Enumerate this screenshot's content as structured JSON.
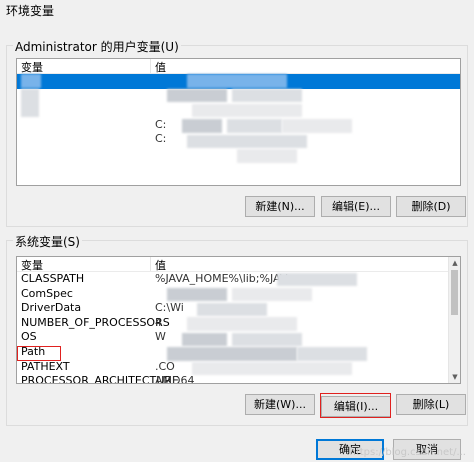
{
  "window": {
    "title": "环境变量"
  },
  "user_vars": {
    "group_label": "Administrator 的用户变量(U)",
    "columns": {
      "name": "变量",
      "value": "值"
    },
    "rows": [
      {
        "name": "",
        "value": ""
      },
      {
        "name": "",
        "value": ""
      },
      {
        "name": "",
        "value": ""
      },
      {
        "name": "",
        "value": "C:"
      },
      {
        "name": "",
        "value": "C:"
      }
    ],
    "buttons": {
      "new": "新建(N)...",
      "edit": "编辑(E)...",
      "delete": "删除(D)"
    }
  },
  "system_vars": {
    "group_label": "系统变量(S)",
    "columns": {
      "name": "变量",
      "value": "值"
    },
    "rows": [
      {
        "name": "CLASSPATH",
        "value": "%JAVA_HOME%\\lib;%JAV"
      },
      {
        "name": "ComSpec",
        "value": ""
      },
      {
        "name": "DriverData",
        "value": "C:\\Wi"
      },
      {
        "name": "NUMBER_OF_PROCESSORS",
        "value": "4"
      },
      {
        "name": "OS",
        "value": "W"
      },
      {
        "name": "Path",
        "value": ""
      },
      {
        "name": "PATHEXT",
        "value": ".CO"
      },
      {
        "name": "PROCESSOR_ARCHITECTURE",
        "value": "AMD64"
      }
    ],
    "buttons": {
      "new": "新建(W)...",
      "edit": "编辑(I)...",
      "delete": "删除(L)"
    }
  },
  "dialog_buttons": {
    "ok": "确定",
    "cancel": "取消"
  },
  "watermark": "https://blog.csdn.net/...",
  "colors": {
    "selection": "#0078d7",
    "highlight_box": "#e0211f",
    "focus_border": "#0078d7"
  }
}
